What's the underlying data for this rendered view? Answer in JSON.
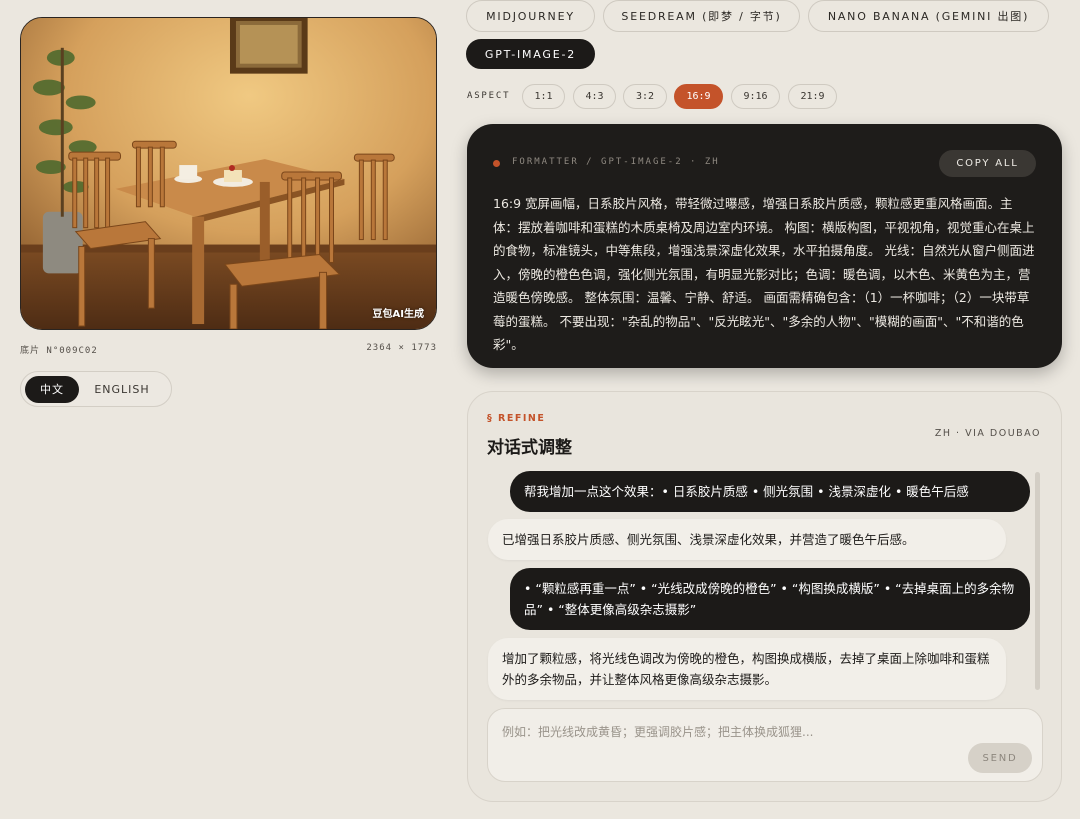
{
  "photo": {
    "alt": "cafe-table-photo",
    "watermark": "豆包AI生成",
    "film_id": "底片 N°009C02",
    "dimensions": "2364 × 1773"
  },
  "language": {
    "options": [
      "中文",
      "ENGLISH"
    ],
    "active": "中文"
  },
  "models": [
    {
      "label": "MIDJOURNEY",
      "active": false
    },
    {
      "label": "SEEDREAM (即梦 / 字节)",
      "active": false
    },
    {
      "label": "NANO BANANA (GEMINI 出图)",
      "active": false
    },
    {
      "label": "GPT-IMAGE-2",
      "active": true
    }
  ],
  "aspect": {
    "label": "ASPECT",
    "options": [
      "1:1",
      "4:3",
      "3:2",
      "16:9",
      "9:16",
      "21:9"
    ],
    "active": "16:9"
  },
  "prompt_card": {
    "formatter_label": "FORMATTER / GPT-IMAGE-2 · ZH",
    "copy_label": "COPY ALL",
    "text": "16:9 宽屏画幅，日系胶片风格，带轻微过曝感，增强日系胶片质感，颗粒感更重风格画面。主体：摆放着咖啡和蛋糕的木质桌椅及周边室内环境。 构图：横版构图，平视视角，视觉重心在桌上的食物，标准镜头，中等焦段，增强浅景深虚化效果，水平拍摄角度。 光线：自然光从窗户侧面进入，傍晚的橙色色调，强化侧光氛围，有明显光影对比；色调：暖色调，以木色、米黄色为主，营造暖色傍晚感。 整体氛围：温馨、宁静、舒适。 画面需精确包含：（1）一杯咖啡；（2）一块带草莓的蛋糕。 不要出现：\"杂乱的物品\"、\"反光眩光\"、\"多余的人物\"、\"模糊的画面\"、\"不和谐的色彩\"。"
  },
  "refine": {
    "kicker": "§ REFINE",
    "title": "对话式调整",
    "via": "ZH · VIA DOUBAO",
    "messages": [
      {
        "role": "user",
        "text": "帮我增加一点这个效果：• 日系胶片质感 • 侧光氛围 • 浅景深虚化 • 暖色午后感"
      },
      {
        "role": "ai",
        "text": "已增强日系胶片质感、侧光氛围、浅景深虚化效果，并营造了暖色午后感。"
      },
      {
        "role": "user",
        "text": "• “颗粒感再重一点” • “光线改成傍晚的橙色” • “构图换成横版” • “去掉桌面上的多余物品” • “整体更像高级杂志摄影”"
      },
      {
        "role": "ai",
        "text": "增加了颗粒感，将光线色调改为傍晚的橙色，构图换成横版，去掉了桌面上除咖啡和蛋糕外的多余物品，并让整体风格更像高级杂志摄影。"
      }
    ],
    "input_placeholder": "例如：把光线改成黄昏；更强调胶片感；把主体换成狐狸...",
    "input_value": "",
    "send_label": "SEND"
  },
  "colors": {
    "background": "#ebe7df",
    "dark": "#1c1a18",
    "accent": "#c4532a"
  }
}
